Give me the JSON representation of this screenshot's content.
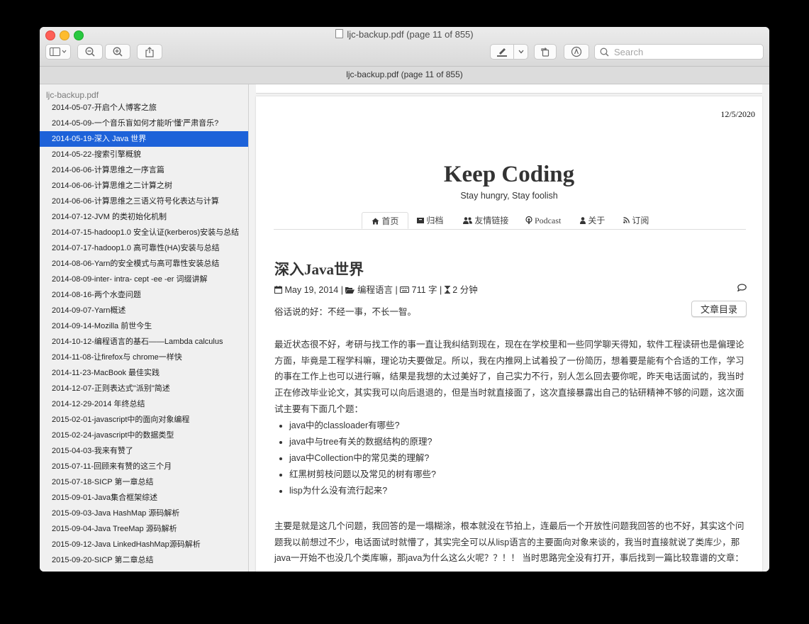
{
  "window": {
    "title": "ljc-backup.pdf (page 11 of 855)",
    "doc_title": "ljc-backup.pdf (page 11 of 855)"
  },
  "toolbar": {
    "search_placeholder": "Search"
  },
  "sidebar": {
    "file_name": "ljc-backup.pdf",
    "items": [
      {
        "label": "2014-05-07-开启个人博客之旅"
      },
      {
        "label": "2014-05-09-一个音乐盲如何才能听'懂'严肃音乐?"
      },
      {
        "label": "2014-05-19-深入 Java 世界",
        "selected": true
      },
      {
        "label": "2014-05-22-搜索引擎概貌"
      },
      {
        "label": "2014-06-06-计算思维之一序言篇"
      },
      {
        "label": "2014-06-06-计算思维之二计算之树"
      },
      {
        "label": "2014-06-06-计算思维之三语义符号化表达与计算"
      },
      {
        "label": "2014-07-12-JVM 的类初始化机制"
      },
      {
        "label": "2014-07-15-hadoop1.0 安全认证(kerberos)安装与总结"
      },
      {
        "label": "2014-07-17-hadoop1.0 高可靠性(HA)安装与总结"
      },
      {
        "label": "2014-08-06-Yarn的安全模式与高可靠性安装总结"
      },
      {
        "label": "2014-08-09-inter- intra- cept -ee -er 词缀讲解"
      },
      {
        "label": "2014-08-16-两个水壶问题"
      },
      {
        "label": "2014-09-07-Yarn概述"
      },
      {
        "label": "2014-09-14-Mozilla 前世今生"
      },
      {
        "label": "2014-10-12-编程语言的基石——Lambda calculus"
      },
      {
        "label": "2014-11-08-让firefox与 chrome一样快"
      },
      {
        "label": "2014-11-23-MacBook 最佳实践"
      },
      {
        "label": "2014-12-07-正则表达式\"派别\"简述"
      },
      {
        "label": "2014-12-29-2014 年终总结"
      },
      {
        "label": "2015-02-01-javascript中的面向对象编程"
      },
      {
        "label": "2015-02-24-javascript中的数据类型"
      },
      {
        "label": "2015-04-03-我来有赞了"
      },
      {
        "label": "2015-07-11-回顾来有赞的这三个月"
      },
      {
        "label": "2015-07-18-SICP 第一章总结"
      },
      {
        "label": "2015-09-01-Java集合框架综述"
      },
      {
        "label": "2015-09-03-Java HashMap 源码解析"
      },
      {
        "label": "2015-09-04-Java TreeMap 源码解析"
      },
      {
        "label": "2015-09-12-Java LinkedHashMap源码解析"
      },
      {
        "label": "2015-09-20-SICP 第二章总结"
      }
    ]
  },
  "page": {
    "date": "12/5/2020",
    "blog_title": "Keep Coding",
    "blog_subtitle": "Stay hungry, Stay foolish",
    "nav": [
      {
        "label": "首页",
        "icon": "home-icon"
      },
      {
        "label": "归档",
        "icon": "archive-icon"
      },
      {
        "label": "友情链接",
        "icon": "users-icon"
      },
      {
        "label": "Podcast",
        "icon": "podcast-icon"
      },
      {
        "label": "关于",
        "icon": "user-icon"
      },
      {
        "label": "订阅",
        "icon": "rss-icon"
      }
    ],
    "post_title": "深入Java世界",
    "meta": {
      "date": "May 19, 2014",
      "category": "编程语言",
      "words": "711 字",
      "read_time": "2 分钟"
    },
    "toc_button": "文章目录",
    "intro": "俗话说的好：不经一事，不长一智。",
    "para1": "最近状态很不好，考研与找工作的事一直让我纠结到现在，现在在学校里和一些同学聊天得知，软件工程读研也是偏理论方面，毕竟是工程学科嘛，理论功夫要做足。所以，我在内推网上试着投了一份简历，想着要是能有个合适的工作，学习的事在工作上也可以进行嘛，结果是我想的太过美好了，自己实力不行，别人怎么回去要你呢，昨天电话面试的，我当时正在修改毕业论文，其实我可以向后退退的，但是当时就直接面了，这次直接暴露出自己的钻研精神不够的问题，这次面试主要有下面几个题：",
    "questions": [
      "java中的classloader有哪些?",
      "java中与tree有关的数据结构的原理?",
      "java中Collection中的常见类的理解?",
      "红黑树剪枝问题以及常见的树有哪些?",
      "lisp为什么没有流行起来?"
    ],
    "para2": "主要是就是这几个问题，我回答的是一塌糊涂，根本就没在节拍上，连最后一个开放性问题我回答的也不好，其实这个问题我以前想过不少，电话面试时就懵了，其实完全可以从lisp语言的主要面向对象来谈的，我当时直接就说了类库少，那java一开始不也没几个类库嘛，那java为什么这么火呢？？！！ 当时思路完全没有打开，事后找到一篇比较靠谱的文章："
  }
}
